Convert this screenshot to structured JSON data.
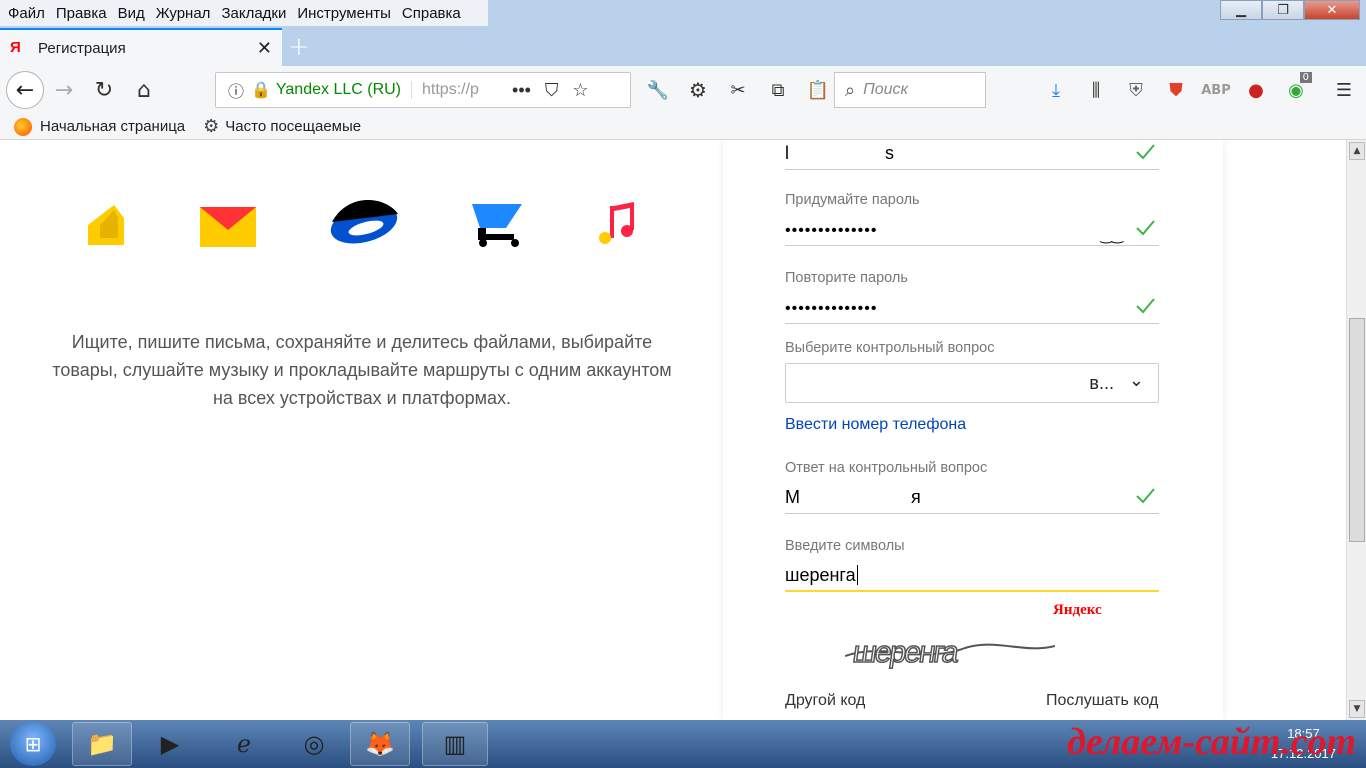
{
  "menu": [
    "Файл",
    "Правка",
    "Вид",
    "Журнал",
    "Закладки",
    "Инструменты",
    "Справка"
  ],
  "tab": {
    "title": "Регистрация",
    "favicon": "Я"
  },
  "urlbar": {
    "org": "Yandex LLC (RU)",
    "url": "https://p",
    "more": "•••"
  },
  "search": {
    "placeholder": "Поиск"
  },
  "badge": "0",
  "bookmarks": [
    "Начальная страница",
    "Часто посещаемые"
  ],
  "promo": {
    "text": "Ищите, пишите письма, сохраняйте и делитесь файлами, выбирайте товары, слушайте музыку и прокладывайте маршруты с одним аккаунтом на всех устройствах и платформах."
  },
  "form": {
    "login_start": "l",
    "login_end": "s",
    "password_label": "Придумайте пароль",
    "password_value": "••••••••••••••",
    "repeat_label": "Повторите пароль",
    "repeat_value": "••••••••••••••",
    "question_label": "Выберите контрольный вопрос",
    "question_value": "в...",
    "phone_link": "Ввести номер телефона",
    "answer_label": "Ответ на контрольный вопрос",
    "answer_start": "М",
    "answer_end": "я",
    "captcha_label": "Введите символы",
    "captcha_value": "шеренга",
    "captcha_brand": "Яндекс",
    "captcha_image_text": "шеренга",
    "other_code": "Другой код",
    "listen_code": "Послушать код"
  },
  "taskbar": {
    "time": "18:57",
    "date": "17.12.2017",
    "watermark": "делаем-сайт.com"
  },
  "colors": {
    "check": "#3bb54a",
    "link": "#0044bb",
    "active_underline": "#ffd82b"
  }
}
